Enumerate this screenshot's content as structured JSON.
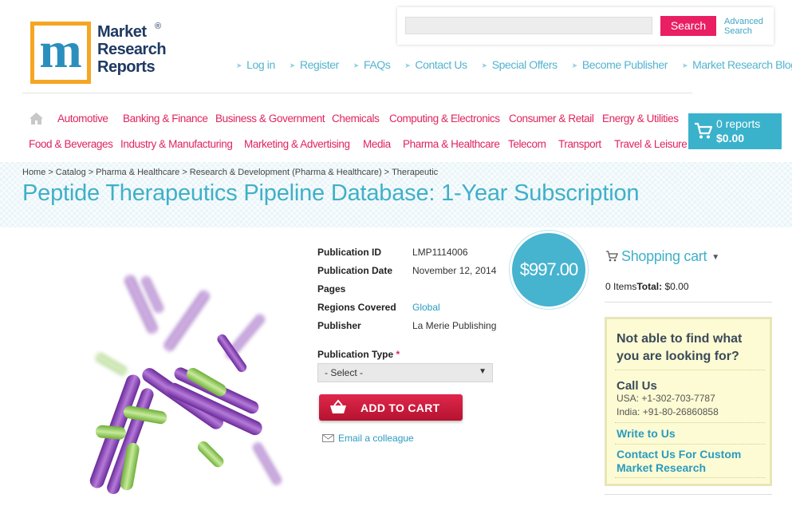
{
  "brand": {
    "logo_text": [
      "Market",
      "Research",
      "Reports"
    ],
    "registered": "®"
  },
  "search": {
    "placeholder": "",
    "button_label": "Search",
    "advanced_label": "Advanced Search"
  },
  "top_links": [
    "Log in",
    "Register",
    "FAQs",
    "Contact Us",
    "Special Offers",
    "Become Publisher",
    "Market Research Blog"
  ],
  "nav": {
    "row1": [
      "Automotive",
      "Banking & Finance",
      "Business & Government",
      "Chemicals",
      "Computing & Electronics",
      "Consumer & Retail",
      "Energy & Utilities"
    ],
    "row2": [
      "Food & Beverages",
      "Industry & Manufacturing",
      "Marketing & Advertising",
      "Media",
      "Pharma & Healthcare",
      "Telecom",
      "Transport",
      "Travel & Leisure"
    ]
  },
  "cart_widget": {
    "count": "0 reports",
    "total": "$0.00"
  },
  "breadcrumb": [
    "Home",
    "Catalog",
    "Pharma & Healthcare",
    "Research & Development (Pharma & Healthcare)",
    "Therapeutic"
  ],
  "page_title": "Peptide Therapeutics Pipeline Database: 1-Year Subscription",
  "details": [
    {
      "label": "Publication ID",
      "value": "LMP1114006",
      "link": false
    },
    {
      "label": "Publication Date",
      "value": "November 12, 2014",
      "link": false
    },
    {
      "label": "Pages",
      "value": "",
      "link": false
    },
    {
      "label": "Regions Covered",
      "value": "Global",
      "link": true
    },
    {
      "label": "Publisher",
      "value": "La Merie Publishing",
      "link": false
    }
  ],
  "price": "$997.00",
  "publication_type": {
    "label": "Publication Type",
    "required_mark": "*",
    "selected": "- Select -"
  },
  "add_to_cart_label": "ADD TO CART",
  "email_label": "Email a colleague",
  "shopping_cart": {
    "title": "Shopping cart",
    "items": "0 Items",
    "total_label": "Total:",
    "total_value": "$0.00"
  },
  "help": {
    "question": "Not able to find what you are looking for?",
    "call_us": "Call Us",
    "phone_usa": "USA: +1-302-703-7787",
    "phone_india": "India: +91-80-26860858",
    "write_to_us": "Write to Us",
    "custom_research": "Contact Us For Custom Market Research"
  },
  "colors": {
    "accent_blue": "#3fb0c9",
    "nav_pink": "#e0245e",
    "search_pink": "#e91e63",
    "logo_orange": "#f5a623"
  }
}
